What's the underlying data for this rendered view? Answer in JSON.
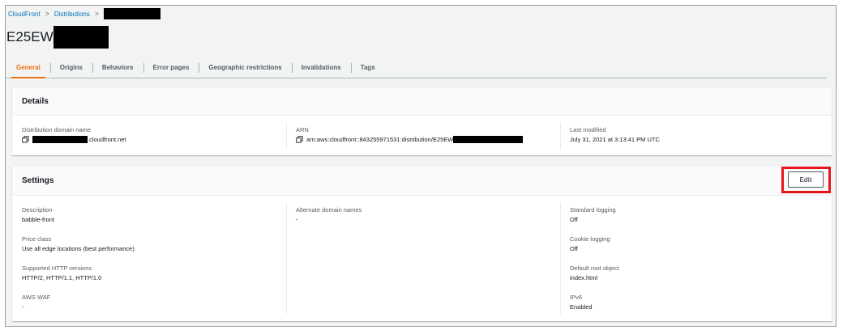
{
  "breadcrumb": {
    "items": [
      "CloudFront",
      "Distributions"
    ],
    "separator": ">"
  },
  "page_title_prefix": "E25EW",
  "tabs": [
    "General",
    "Origins",
    "Behaviors",
    "Error pages",
    "Geographic restrictions",
    "Invalidations",
    "Tags"
  ],
  "active_tab": "General",
  "details": {
    "header": "Details",
    "domain_label": "Distribution domain name",
    "domain_suffix": ".cloudfront.net",
    "arn_label": "ARN",
    "arn_prefix": "arn:aws:cloudfront::843255971531:distribution/E25EW",
    "modified_label": "Last modified",
    "modified_value": "July 31, 2021 at 3:13:41 PM UTC"
  },
  "settings": {
    "header": "Settings",
    "edit_label": "Edit",
    "description_label": "Description",
    "description_value": "babble-front",
    "price_label": "Price class",
    "price_value": "Use all edge locations (best performance)",
    "http_label": "Supported HTTP versions",
    "http_value": "HTTP/2, HTTP/1.1, HTTP/1.0",
    "waf_label": "AWS WAF",
    "waf_value": "-",
    "alt_label": "Alternate domain names",
    "alt_value": "-",
    "std_log_label": "Standard logging",
    "std_log_value": "Off",
    "cookie_label": "Cookie logging",
    "cookie_value": "Off",
    "root_label": "Default root object",
    "root_value": "index.html",
    "ipv6_label": "IPv6",
    "ipv6_value": "Enabled"
  },
  "colors": {
    "accent": "#ec7211",
    "link": "#0073bb",
    "highlight": "#e4151f"
  },
  "icons": [
    "copy-icon",
    "chevron-right-icon"
  ]
}
